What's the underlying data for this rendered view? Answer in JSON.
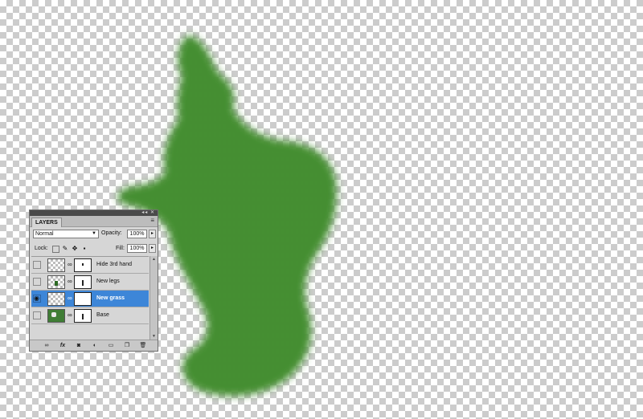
{
  "colors": {
    "grass": "#3f8a2e",
    "selection": "#3d86d8",
    "panel_bg": "#d6d6d6"
  },
  "layers_panel": {
    "tab_label": "LAYERS",
    "titlebar_buttons": "◂◂ ✕",
    "menu_icon": "≡",
    "blend_mode": "Normal",
    "opacity_label": "Opacity:",
    "opacity_value": "100%",
    "lock_label": "Lock:",
    "fill_label": "Fill:",
    "fill_value": "100%",
    "layers": [
      {
        "name": "Hide 3rd hand",
        "visible": false,
        "selected": false
      },
      {
        "name": "New legs",
        "visible": false,
        "selected": false
      },
      {
        "name": "New grass",
        "visible": true,
        "selected": true
      },
      {
        "name": "Base",
        "visible": false,
        "selected": false
      }
    ],
    "footer_icons": [
      "link-layers-icon",
      "fx-icon",
      "mask-icon",
      "adjustment-icon",
      "group-icon",
      "new-layer-icon",
      "trash-icon"
    ]
  }
}
